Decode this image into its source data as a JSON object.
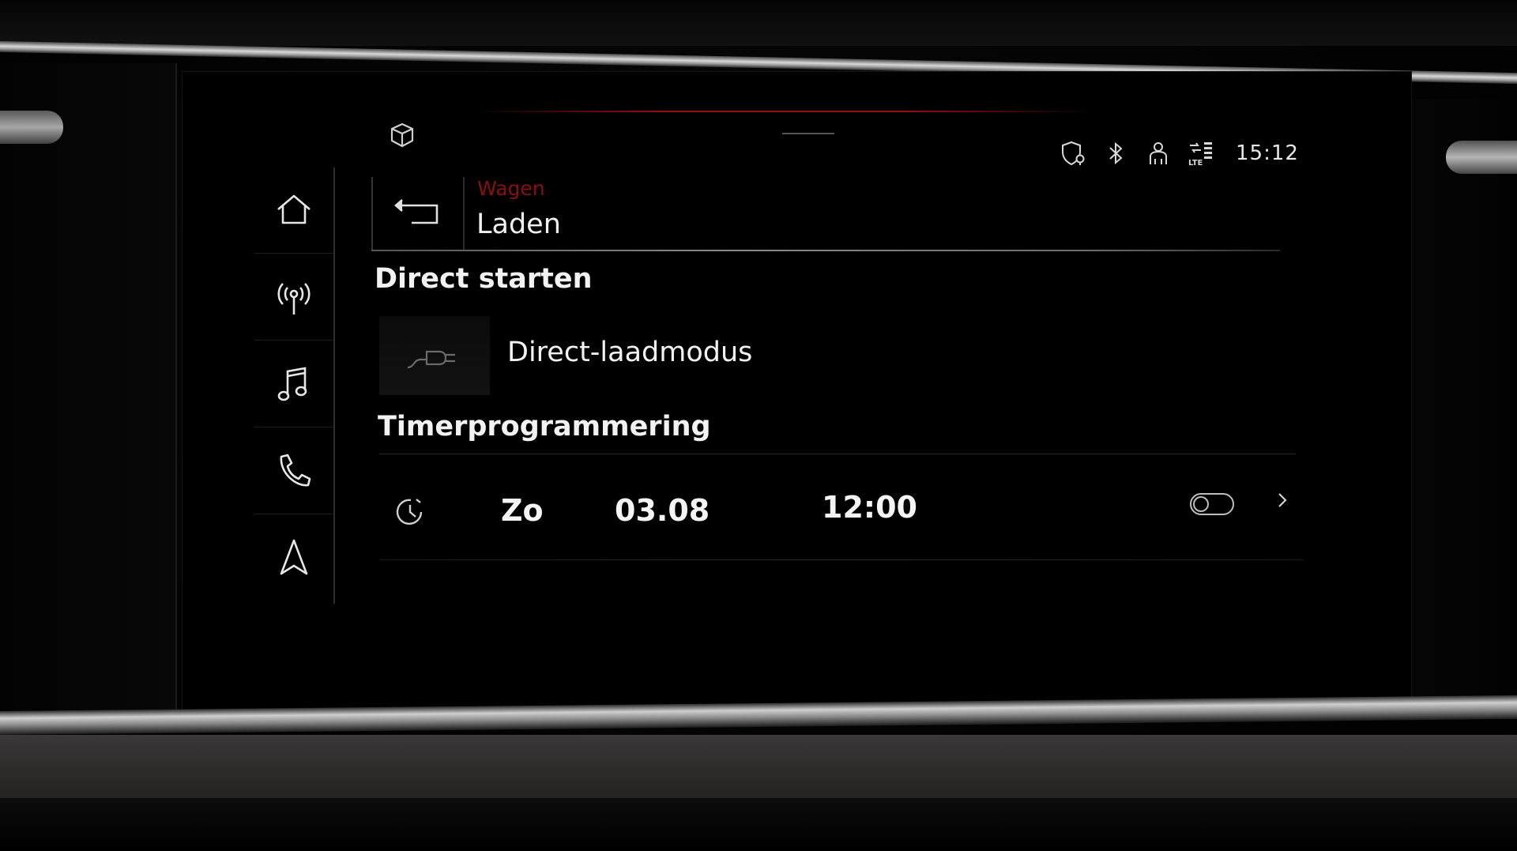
{
  "status_bar": {
    "clock": "15:12",
    "icons": [
      "privacy-shield-icon",
      "bluetooth-icon",
      "user-profile-icon",
      "lte-signal-icon"
    ]
  },
  "top_bar": {
    "app_icon": "cube-icon"
  },
  "sidebar": {
    "items": [
      {
        "icon": "home-icon"
      },
      {
        "icon": "radio-antenna-icon"
      },
      {
        "icon": "music-note-icon"
      },
      {
        "icon": "phone-icon"
      },
      {
        "icon": "navigation-arrow-icon"
      }
    ]
  },
  "header": {
    "breadcrumb": "Wagen",
    "title": "Laden",
    "back_icon": "back-arrow-icon"
  },
  "direct_section": {
    "title": "Direct starten",
    "item_label": "Direct-laadmodus",
    "item_icon": "charging-plug-icon"
  },
  "timer_section": {
    "title": "Timerprogrammering",
    "timer": {
      "icon": "timer-clock-icon",
      "day": "Zo",
      "date": "03.08",
      "time": "12:00",
      "enabled": false
    }
  },
  "colors": {
    "accent_red": "#8a0e0e",
    "text": "#f2f2f2",
    "background": "#000000"
  }
}
